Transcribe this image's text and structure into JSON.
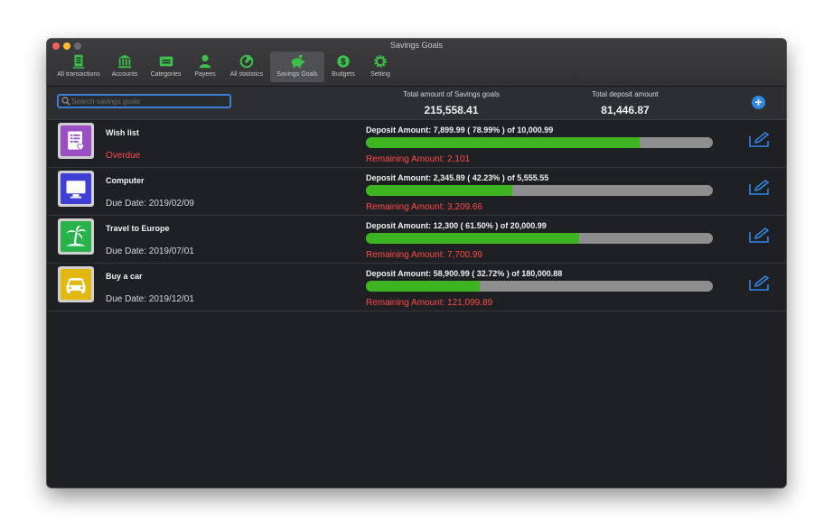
{
  "window": {
    "title": "Savings Goals"
  },
  "toolbar": {
    "items": [
      {
        "label": "All transactions",
        "icon": "ledger-icon",
        "active": false
      },
      {
        "label": "Accounts",
        "icon": "bank-icon",
        "active": false
      },
      {
        "label": "Categories",
        "icon": "categories-icon",
        "active": false
      },
      {
        "label": "Payees",
        "icon": "person-icon",
        "active": false
      },
      {
        "label": "All statistics",
        "icon": "statistics-icon",
        "active": false
      },
      {
        "label": "Savings Goals",
        "icon": "piggy-bank-icon",
        "active": true
      },
      {
        "label": "Budgets",
        "icon": "budget-icon",
        "active": false
      },
      {
        "label": "Setting",
        "icon": "gear-icon",
        "active": false
      }
    ]
  },
  "search": {
    "placeholder": "Search savings goals",
    "value": ""
  },
  "summary": {
    "total_label": "Total amount of Savings goals",
    "total_value": "215,558.41",
    "deposit_label": "Total deposit amount",
    "deposit_value": "81,446.87"
  },
  "goals": [
    {
      "name": "Wish list",
      "sub": "Overdue",
      "sub_status": "overdue",
      "icon": "wishlist-icon",
      "icon_bg": "#9b4fc4",
      "deposit_text": "Deposit Amount: 7,899.99 ( 78.99% ) of 10,000.99",
      "progress": 0.7899,
      "remaining": "Remaining Amount: 2,101"
    },
    {
      "name": "Computer",
      "sub": "Due Date: 2019/02/09",
      "sub_status": "due",
      "icon": "monitor-icon",
      "icon_bg": "#3f3fd6",
      "deposit_text": "Deposit Amount: 2,345.89 ( 42.23% ) of 5,555.55",
      "progress": 0.4223,
      "remaining": "Remaining Amount: 3,209.66"
    },
    {
      "name": "Travel to Europe",
      "sub": "Due Date: 2019/07/01",
      "sub_status": "due",
      "icon": "palm-tree-icon",
      "icon_bg": "#27b34a",
      "deposit_text": "Deposit Amount: 12,300 ( 61.50% ) of 20,000.99",
      "progress": 0.615,
      "remaining": "Remaining Amount: 7,700.99"
    },
    {
      "name": "Buy a car",
      "sub": "Due Date: 2019/12/01",
      "sub_status": "due",
      "icon": "car-icon",
      "icon_bg": "#e3b80e",
      "deposit_text": "Deposit Amount: 58,900.99 ( 32.72% ) of 180,000.88",
      "progress": 0.3272,
      "remaining": "Remaining Amount: 121,099.89"
    }
  ],
  "colors": {
    "accent": "#2f88e8",
    "progress_green": "#3cb521",
    "alert_red": "#ff4a4a"
  }
}
